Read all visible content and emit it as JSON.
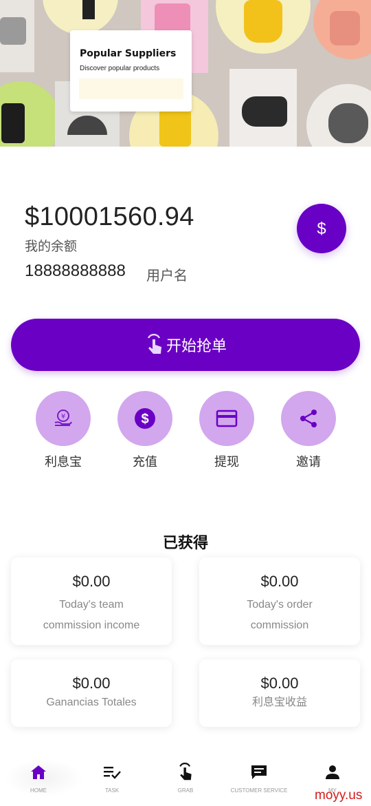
{
  "banner": {
    "title": "Popular Suppliers",
    "subtitle": "Discover popular products"
  },
  "account": {
    "balance": "$10001560.94",
    "balance_label": "我的余额",
    "phone": "18888888888",
    "username_label": "用户名",
    "dollar_icon": "dollar-sign-icon"
  },
  "start_button": {
    "label": "开始抢单",
    "icon": "tap-hand-icon"
  },
  "actions": [
    {
      "label": "利息宝",
      "icon": "interest-coin-hand-icon"
    },
    {
      "label": "充值",
      "icon": "dollar-circle-icon"
    },
    {
      "label": "提现",
      "icon": "card-icon"
    },
    {
      "label": "邀请",
      "icon": "share-icon"
    }
  ],
  "earned": {
    "title": "已获得",
    "cards": [
      {
        "value": "$0.00",
        "desc_line1": "Today's team",
        "desc_line2": "commission income"
      },
      {
        "value": "$0.00",
        "desc_line1": "Today's order",
        "desc_line2": "commission"
      },
      {
        "value": "$0.00",
        "desc_line1": "Ganancias Totales",
        "desc_line2": ""
      },
      {
        "value": "$0.00",
        "desc_line1": "利息宝收益",
        "desc_line2": ""
      }
    ]
  },
  "nav": [
    {
      "label": "HOME",
      "icon": "home-icon",
      "active": true
    },
    {
      "label": "TASK",
      "icon": "task-list-icon",
      "active": false
    },
    {
      "label": "GRAB",
      "icon": "tap-hand-icon",
      "active": false
    },
    {
      "label": "CUSTOMER SERVICE",
      "icon": "chat-icon",
      "active": false
    },
    {
      "label": "MY",
      "icon": "person-icon",
      "active": false
    }
  ],
  "watermark": "moyy.us",
  "colors": {
    "accent": "#6a00c4",
    "action_circle": "#d2a7ee",
    "nav_active": "#6a00c4"
  }
}
